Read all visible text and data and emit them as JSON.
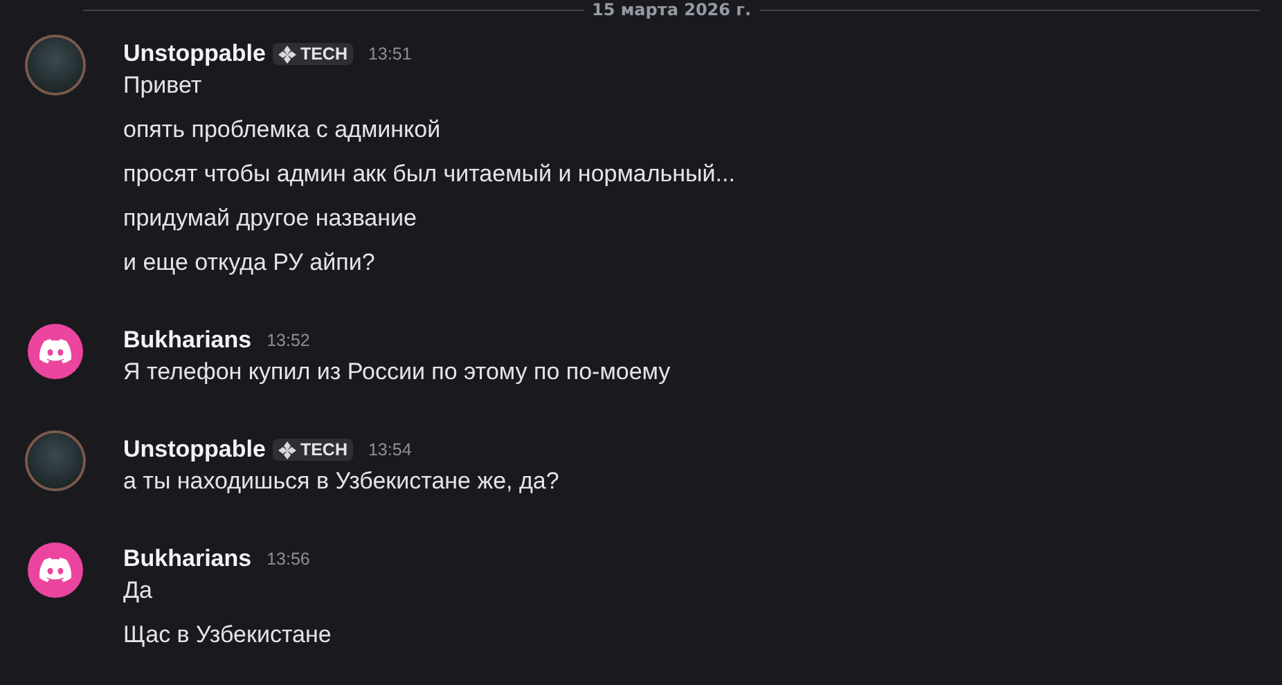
{
  "date_divider": "15 марта 2026 г.",
  "messages": [
    {
      "author": "Unstoppable",
      "avatar": {
        "kind": "photo"
      },
      "badge": "TECH",
      "time": "13:51",
      "lines": [
        "Привет",
        "опять проблемка с админкой",
        "просят чтобы админ акк был читаемый и нормальный...",
        "придумай другое название",
        "и еще откуда РУ айпи?"
      ]
    },
    {
      "author": "Bukharians",
      "avatar": {
        "kind": "default",
        "color": "#eb459f"
      },
      "time": "13:52",
      "lines": [
        "Я телефон купил из России по этому по по-моему"
      ]
    },
    {
      "author": "Unstoppable",
      "avatar": {
        "kind": "photo"
      },
      "badge": "TECH",
      "time": "13:54",
      "lines": [
        "а ты находишься в Узбекистане же, да?"
      ]
    },
    {
      "author": "Bukharians",
      "avatar": {
        "kind": "default",
        "color": "#eb459f"
      },
      "time": "13:56",
      "lines": [
        "Да",
        "Щас в Узбекистане"
      ]
    }
  ]
}
